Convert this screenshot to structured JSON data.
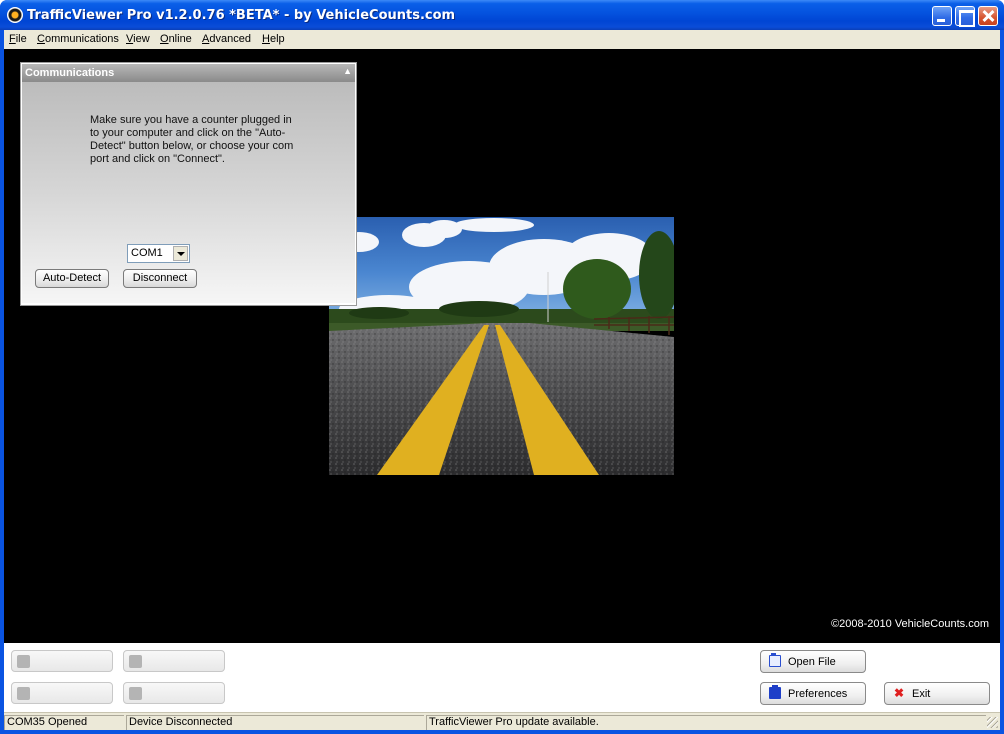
{
  "window": {
    "title": "TrafficViewer Pro  v1.2.0.76 *BETA* - by VehicleCounts.com"
  },
  "menu": {
    "items": [
      {
        "prefix": "",
        "accel": "F",
        "rest": "ile"
      },
      {
        "prefix": "",
        "accel": "C",
        "rest": "ommunications"
      },
      {
        "prefix": "",
        "accel": "V",
        "rest": "iew"
      },
      {
        "prefix": "",
        "accel": "O",
        "rest": "nline"
      },
      {
        "prefix": "",
        "accel": "A",
        "rest": "dvanced"
      },
      {
        "prefix": "",
        "accel": "H",
        "rest": "elp"
      }
    ]
  },
  "comm_panel": {
    "title": "Communications",
    "collapse_glyph": "▲",
    "message": "Make sure you have a counter plugged in to your computer and click on the \"Auto-Detect\" button below, or choose your com port and click on \"Connect\".",
    "port_selected": "COM1",
    "auto_detect_label": "Auto-Detect",
    "disconnect_label": "Disconnect"
  },
  "main": {
    "copyright": "©2008-2010 VehicleCounts.com"
  },
  "bottom": {
    "open_file_label": "Open File",
    "preferences_label": "Preferences",
    "exit_label": "Exit"
  },
  "status": {
    "port": "COM35 Opened",
    "device": "Device Disconnected",
    "update": "TrafficViewer Pro update available."
  },
  "colors": {
    "titlebar": "#0554e0",
    "main_bg": "#000000",
    "road_line": "#e0b020"
  }
}
